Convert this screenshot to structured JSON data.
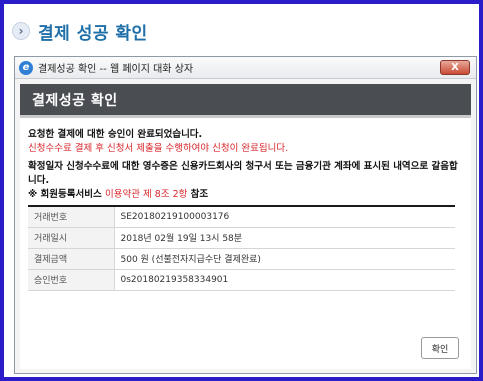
{
  "page": {
    "title": "결제 성공 확인"
  },
  "window": {
    "title": "결제성공 확인 -- 웹 페이지 대화 상자",
    "close_label": "X"
  },
  "dialog": {
    "title": "결제성공 확인",
    "messages": {
      "approved": "요청한 결제에 대한 승인이 완료되었습니다.",
      "warning": "신청수수료 결제 후 신청서 제출을 수행하여야 신청이 완료됩니다.",
      "receipt": "확정일자 신청수수료에 대한 영수증은 신용카드회사의 청구서 또는 금융기관 계좌에 표시된 내역으로 갈음합니다.",
      "membership_prefix": "※ 회원등록서비스 ",
      "membership_link": "이용약관 제 8조 2항",
      "membership_suffix": " 참조"
    },
    "rows": [
      {
        "label": "거래번호",
        "value": "SE20180219100003176"
      },
      {
        "label": "거래일시",
        "value": "2018년 02월 19일 13시 58분"
      },
      {
        "label": "결제금액",
        "value": "500 원 (선불전자지급수단 결제완료)"
      },
      {
        "label": "승인번호",
        "value": "0s20180219358334901"
      }
    ],
    "confirm_label": "확인"
  }
}
